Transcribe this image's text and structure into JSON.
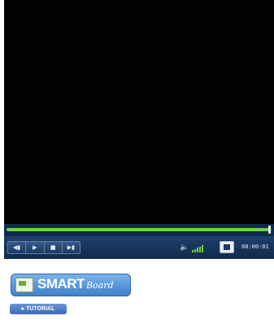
{
  "player": {
    "progress_fraction": 0.99,
    "controls": {
      "rewind_icon": "rewind-icon",
      "play_icon": "play-icon",
      "stop_icon": "stop-icon",
      "forward_icon": "forward-icon"
    },
    "volume": {
      "icon": "speaker-icon",
      "level_bars": 5
    },
    "fullscreen_icon": "fullscreen-icon",
    "time": "00:00:01",
    "colors": {
      "video_bg": "#020202",
      "progress_fill": "#6fd23a",
      "controls_bg": "#1e3f6b"
    }
  },
  "branding": {
    "smart": "SMART",
    "board": "Board"
  },
  "tutorial": {
    "label": "▸ TUTORIAL"
  }
}
